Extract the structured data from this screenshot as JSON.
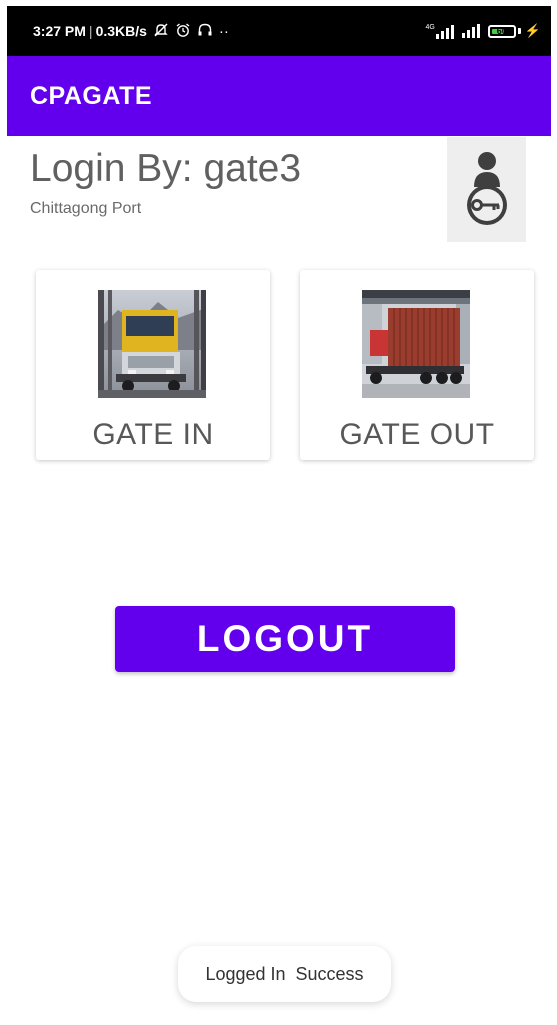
{
  "status_bar": {
    "time": "3:27 PM",
    "separator": "|",
    "speed": "0.3KB/s",
    "icons": [
      "mute-icon",
      "alarm-icon",
      "headset-icon"
    ],
    "more": "··",
    "network_label": "4G",
    "battery_level": "60",
    "battery_fraction": 0.6
  },
  "app_bar": {
    "title": "CPAGATE"
  },
  "login": {
    "title": "Login By: gate3",
    "subtitle": "Chittagong Port",
    "profile_icon": "user-key-icon"
  },
  "gates": [
    {
      "label": "GATE IN",
      "image": "truck-at-gate-image"
    },
    {
      "label": "GATE OUT",
      "image": "container-truck-image"
    }
  ],
  "logout": {
    "label": "LOGOUT"
  },
  "toast": {
    "message": "Logged In  Success"
  },
  "colors": {
    "primary": "#6200ee",
    "status_bar": "#000000",
    "text_gray": "#606060"
  }
}
